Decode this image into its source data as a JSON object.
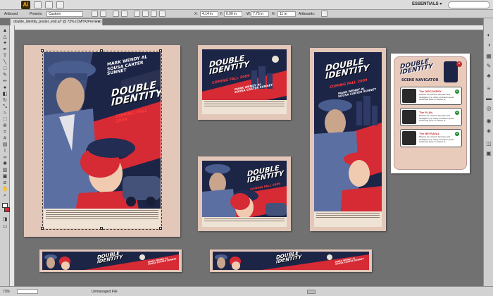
{
  "app": {
    "logo": "Ai",
    "workspace": "ESSENTIALS ▾"
  },
  "control_bar": {
    "tool_label": "Artboard",
    "presets_label": "Presets:",
    "preset_value": "Custom",
    "x_label": "X:",
    "x_value": "4.14 in",
    "y_label": "Y:",
    "y_value": "6.90 in",
    "w_label": "W:",
    "w_value": "7.75 in",
    "h_label": "H:",
    "h_value": "11 in",
    "artboards_label": "Artboards:"
  },
  "document_tab": {
    "title": "double_identity_poster_end.ai* @ 73% (CMYK/Preview)",
    "close": "×"
  },
  "poster": {
    "title": "DOUBLE\nIDENTITY",
    "tagline": "COMING FALL 2009",
    "names": "MARK   WENDY   AL\nSOUSA  CARTER  SUNNET"
  },
  "navigator": {
    "title": "DOUBLE\nIDENTITY",
    "subtitle": "SCENE NAVIGATOR",
    "close": "×",
    "scenes": [
      {
        "title": "The DISCOVERY",
        "desc": "Phasos vis volvenis fenanas velit nestigans ly ip missy ut duamin quom solubt pat quas on selicet ra",
        "plus": "+"
      },
      {
        "title": "The PLAN",
        "desc": "Phasos vis volvenis fenanas velit nestigans ly ip missy ut duamin quom solubt pat quas on selicet ra",
        "plus": "+"
      },
      {
        "title": "The BETRAYAL",
        "desc": "Phasos vis volvenis fenanas velit nestigans ly ip missy ut duamin quom solubt pat quas on selicet ra",
        "plus": "+"
      }
    ]
  },
  "status_bar": {
    "zoom": "73%",
    "info": "Unmanaged File"
  },
  "colors": {
    "board": "#e3c7b8",
    "navy": "#1d2547",
    "red": "#d62a35",
    "pasteboard": "#717171"
  }
}
